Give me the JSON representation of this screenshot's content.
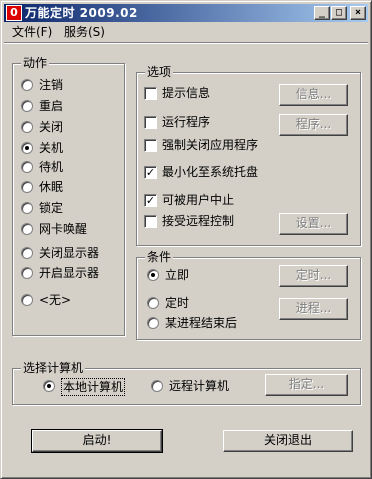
{
  "window": {
    "title": "万能定时 2009.02",
    "icon": "power-icon",
    "minimize": "_",
    "maximize": "□",
    "close": "×"
  },
  "menu": {
    "file": "文件(F)",
    "service": "服务(S)"
  },
  "action_group": {
    "title": "动作",
    "items": [
      "注销",
      "重启",
      "关闭",
      "关机",
      "待机",
      "休眠",
      "锁定",
      "网卡唤醒",
      "关闭显示器",
      "开启显示器",
      "<无>"
    ],
    "selected": "关机"
  },
  "options_group": {
    "title": "选项",
    "items": [
      {
        "label": "提示信息",
        "checked": false,
        "button": "信息..."
      },
      {
        "label": "运行程序",
        "checked": false,
        "button": "程序..."
      },
      {
        "label": "强制关闭应用程序",
        "checked": false
      },
      {
        "label": "最小化至系统托盘",
        "checked": true
      },
      {
        "label": "可被用户中止",
        "checked": true
      },
      {
        "label": "接受远程控制",
        "checked": false,
        "button": "设置..."
      }
    ]
  },
  "condition_group": {
    "title": "条件",
    "items": [
      {
        "label": "立即",
        "selected": true
      },
      {
        "label": "定时",
        "selected": false,
        "button": "定时..."
      },
      {
        "label": "某进程结束后",
        "selected": false,
        "button": "进程..."
      }
    ]
  },
  "computer_group": {
    "title": "选择计算机",
    "local": "本地计算机",
    "remote": "远程计算机",
    "selected": "local",
    "assign_button": "指定..."
  },
  "footer": {
    "start": "启动!",
    "exit": "关闭退出"
  }
}
